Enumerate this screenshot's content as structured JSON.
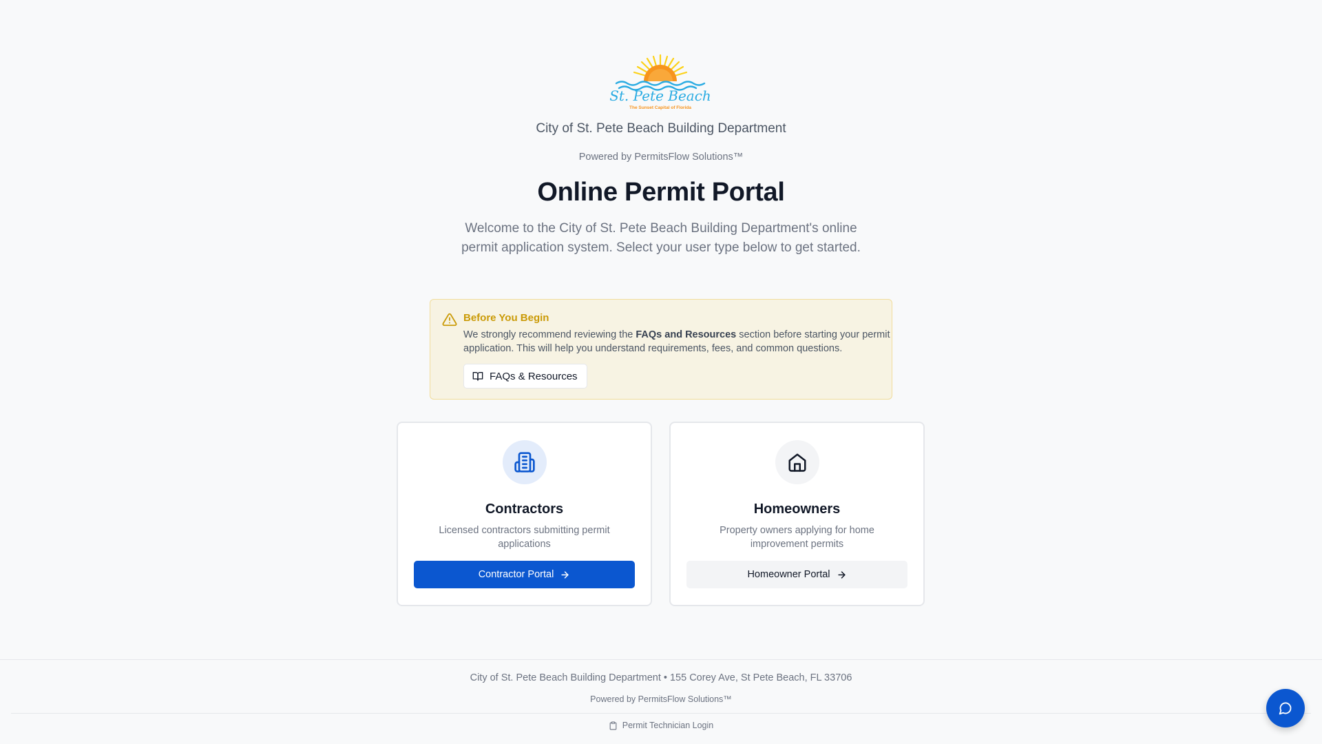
{
  "header": {
    "logo_script": "St. Pete Beach",
    "logo_tagline": "The Sunset Capital of Florida",
    "department": "City of St. Pete Beach Building Department",
    "powered_by": "Powered by PermitsFlow Solutions™"
  },
  "hero": {
    "title": "Online Permit Portal",
    "welcome": "Welcome to the City of St. Pete Beach Building Department's online permit application system. Select your user type below to get started."
  },
  "notice": {
    "icon": "warning-triangle-icon",
    "heading": "Before You Begin",
    "text_before": "We strongly recommend reviewing the ",
    "text_bold": "FAQs and Resources",
    "text_after": " section before starting your permit application. This will help you understand requirements, fees, and common questions.",
    "button_label": "FAQs & Resources",
    "button_icon": "book-open-icon"
  },
  "cards": {
    "contractors": {
      "icon": "building-icon",
      "title": "Contractors",
      "description": "Licensed contractors submitting permit applications",
      "button_label": "Contractor Portal",
      "button_icon": "arrow-right-icon"
    },
    "homeowners": {
      "icon": "house-icon",
      "title": "Homeowners",
      "description": "Property owners applying for home improvement permits",
      "button_label": "Homeowner Portal",
      "button_icon": "arrow-right-icon"
    }
  },
  "footer": {
    "address": "City of St. Pete Beach Building Department • 155 Corey Ave, St Pete Beach, FL 33706",
    "powered_by": "Powered by PermitsFlow Solutions™",
    "tech_login": "Permit Technician Login",
    "tech_login_icon": "clipboard-icon"
  },
  "chat": {
    "icon": "chat-bubble-icon"
  },
  "colors": {
    "primary": "#0b57d0",
    "notice_bg": "#f7f3e3",
    "notice_border": "#f1dd9a",
    "notice_heading": "#ca9a06",
    "sun_orange": "#f7941d",
    "sun_yellow": "#fcd116",
    "wave_blue": "#29abe2"
  }
}
